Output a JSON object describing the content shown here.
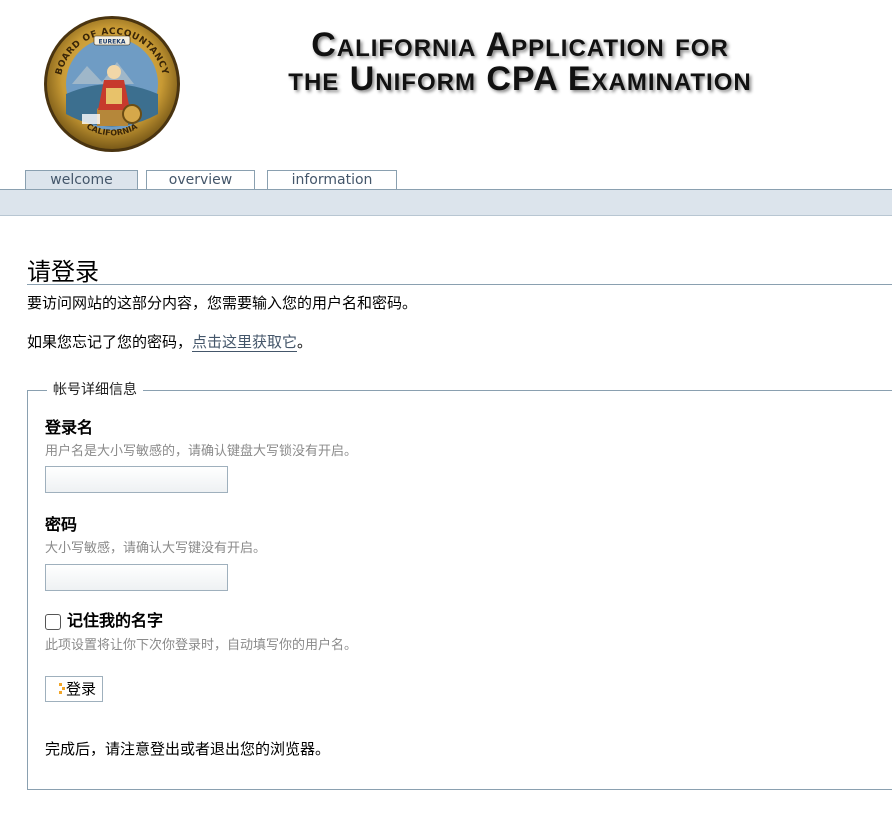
{
  "header": {
    "seal_text_top": "BOARD OF ACCOUNTANCY",
    "seal_text_ribbon": "EUREKA",
    "seal_text_bottom": "CALIFORNIA",
    "banner_line1": "California Application for",
    "banner_line2": "the Uniform CPA Examination"
  },
  "tabs": [
    {
      "label": "welcome",
      "active": true
    },
    {
      "label": "overview",
      "active": false
    },
    {
      "label": "information",
      "active": false
    }
  ],
  "main": {
    "title": "请登录",
    "intro": "要访问网站的这部分内容，您需要输入您的用户名和密码。",
    "forgot_prefix": "如果您忘记了您的密码，",
    "forgot_link": "点击这里获取它",
    "forgot_suffix": "。"
  },
  "form": {
    "legend": "帐号详细信息",
    "username_label": "登录名",
    "username_hint": "用户名是大小写敏感的，请确认键盘大写锁没有开启。",
    "username_value": "",
    "password_label": "密码",
    "password_hint": "大小写敏感，请确认大写键没有开启。",
    "password_value": "",
    "remember_label": "记住我的名字",
    "remember_checked": false,
    "remember_hint": "此项设置将让你下次你登录时，自动填写你的用户名。",
    "login_button": "登录",
    "logout_note": "完成后，请注意登出或者退出您的浏览器。"
  },
  "colors": {
    "tab_text": "#44566a",
    "tab_bar": "#dce4ec",
    "border": "#8aa0b0",
    "hint": "#8a8a8a",
    "link": "#44566a"
  }
}
